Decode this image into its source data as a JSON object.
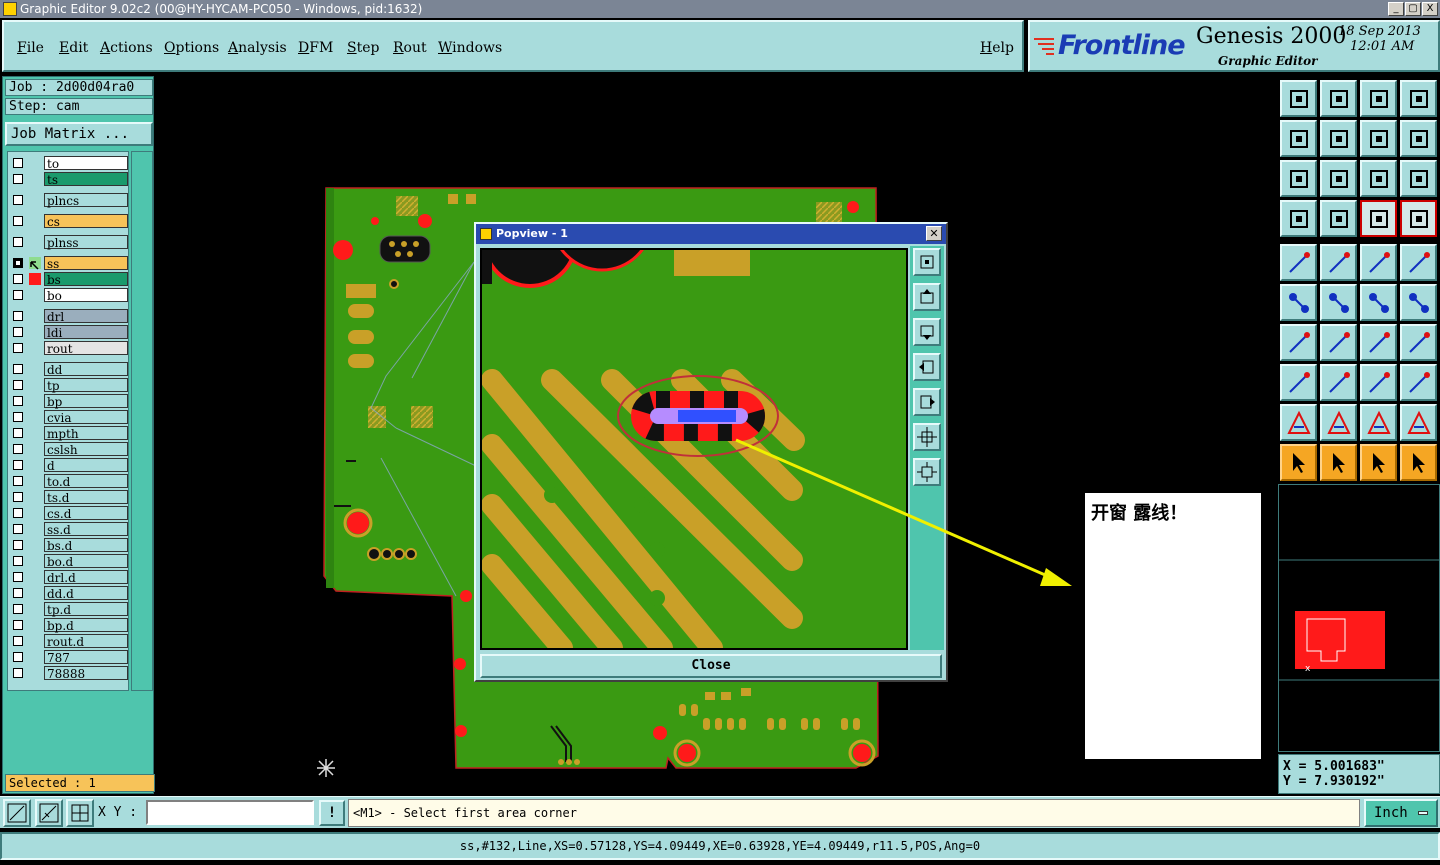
{
  "window": {
    "title": "Graphic Editor 9.02c2 (00@HY-HYCAM-PC050 - Windows, pid:1632)",
    "controls": [
      "_",
      "▢",
      "X"
    ]
  },
  "menu": {
    "file": "File",
    "edit": "Edit",
    "actions": "Actions",
    "options": "Options",
    "analysis": "Analysis",
    "dfm": "DFM",
    "step": "Step",
    "rout": "Rout",
    "windows": "Windows",
    "help": "Help"
  },
  "brand": {
    "name": "Frontline",
    "product": "Genesis 2000",
    "subtitle": "Graphic Editor",
    "date": "18 Sep 2013",
    "time": "12:01 AM"
  },
  "job": {
    "job_line": "Job : 2d00d04ra0",
    "step_line": "Step: cam",
    "matrix_button": "Job Matrix ..."
  },
  "layers": [
    {
      "name": "to",
      "color": "#ffffff",
      "checked": false
    },
    {
      "name": "ts",
      "color": "#1a9a6c",
      "checked": false
    },
    {
      "name": "plncs",
      "color": "#a8dcdc",
      "checked": false
    },
    {
      "name": "cs",
      "color": "#f7c359",
      "checked": false
    },
    {
      "name": "plnss",
      "color": "#a8dcdc",
      "checked": false
    },
    {
      "name": "ss",
      "color": "#f7c359",
      "checked": true,
      "marker": "work"
    },
    {
      "name": "bs",
      "color": "#1a9a6c",
      "checked": false,
      "marker": "red"
    },
    {
      "name": "bo",
      "color": "#ffffff",
      "checked": false
    },
    {
      "name": "drl",
      "color": "#9aaebd",
      "checked": false
    },
    {
      "name": "ldi",
      "color": "#9aaebd",
      "checked": false
    },
    {
      "name": "rout",
      "color": "#e4e4e4",
      "checked": false
    },
    {
      "name": "dd",
      "color": "#a8dcdc",
      "checked": false
    },
    {
      "name": "tp",
      "color": "#a8dcdc",
      "checked": false
    },
    {
      "name": "bp",
      "color": "#a8dcdc",
      "checked": false
    },
    {
      "name": "cvia",
      "color": "#a8dcdc",
      "checked": false
    },
    {
      "name": "mpth",
      "color": "#a8dcdc",
      "checked": false
    },
    {
      "name": "cslsh",
      "color": "#a8dcdc",
      "checked": false
    },
    {
      "name": "d",
      "color": "#a8dcdc",
      "checked": false
    },
    {
      "name": "to.d",
      "color": "#a8dcdc",
      "checked": false
    },
    {
      "name": "ts.d",
      "color": "#a8dcdc",
      "checked": false
    },
    {
      "name": "cs.d",
      "color": "#a8dcdc",
      "checked": false
    },
    {
      "name": "ss.d",
      "color": "#a8dcdc",
      "checked": false
    },
    {
      "name": "bs.d",
      "color": "#a8dcdc",
      "checked": false
    },
    {
      "name": "bo.d",
      "color": "#a8dcdc",
      "checked": false
    },
    {
      "name": "drl.d",
      "color": "#a8dcdc",
      "checked": false
    },
    {
      "name": "dd.d",
      "color": "#a8dcdc",
      "checked": false
    },
    {
      "name": "tp.d",
      "color": "#a8dcdc",
      "checked": false
    },
    {
      "name": "bp.d",
      "color": "#a8dcdc",
      "checked": false
    },
    {
      "name": "rout.d",
      "color": "#a8dcdc",
      "checked": false
    },
    {
      "name": "787",
      "color": "#a8dcdc",
      "checked": false
    },
    {
      "name": "78888",
      "color": "#a8dcdc",
      "checked": false
    }
  ],
  "selection": {
    "label": "Selected : 1"
  },
  "popview": {
    "title": "Popview - 1",
    "close_label": "Close",
    "tools": [
      "zoom-fit-icon",
      "pan-up-icon",
      "pan-down-icon",
      "pan-left-icon",
      "pan-right-icon",
      "zoom-in-icon",
      "zoom-out-icon"
    ]
  },
  "annotation": {
    "text": "开窗 露线！"
  },
  "coords": {
    "x_line": "X = 5.001683\"",
    "y_line": "Y = 7.930192\""
  },
  "bottom": {
    "xy_label": "X Y :",
    "xy_value": "",
    "excl_label": "!",
    "prompt": "<M1> - Select first area corner",
    "unit": "Inch",
    "status": "ss,#132,Line,XS=0.57128,YS=4.09449,XE=0.63928,YE=4.09449,r11.5,POS,Ang=0"
  },
  "colors": {
    "panel": "#a8dcdc",
    "panel_dark": "#4fc5ad",
    "board_green": "#3a9a12",
    "copper": "#c9a028",
    "pad_red": "#ff1a1a",
    "arrow": "#f0f000"
  }
}
